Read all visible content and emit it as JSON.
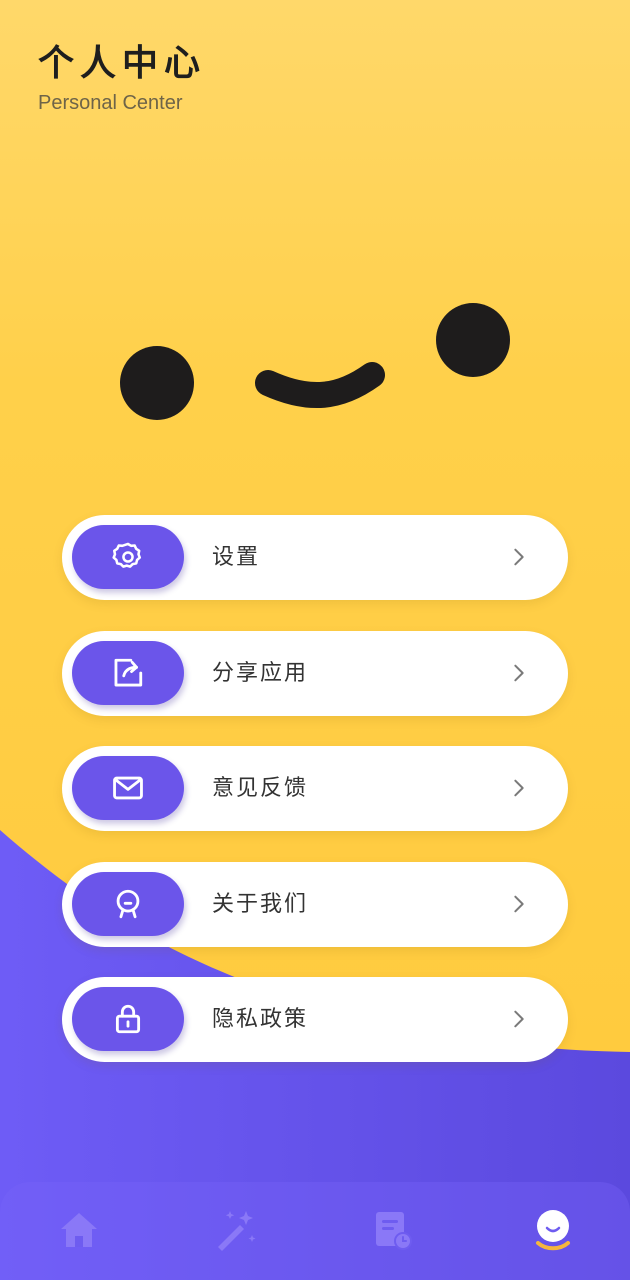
{
  "header": {
    "title": "个人中心",
    "subtitle": "Personal Center"
  },
  "menu": [
    {
      "label": "设置",
      "icon": "gear-icon"
    },
    {
      "label": "分享应用",
      "icon": "share-icon"
    },
    {
      "label": "意见反馈",
      "icon": "mail-icon"
    },
    {
      "label": "关于我们",
      "icon": "about-icon"
    },
    {
      "label": "隐私政策",
      "icon": "lock-icon"
    }
  ],
  "tabbar": {
    "items": [
      {
        "icon": "home-icon",
        "active": false
      },
      {
        "icon": "magic-wand-icon",
        "active": false
      },
      {
        "icon": "document-clock-icon",
        "active": false
      },
      {
        "icon": "smile-face-icon",
        "active": true
      }
    ]
  },
  "colors": {
    "background_yellow": "#FFD04A",
    "accent_purple": "#6B55EA",
    "card_white": "#FFFFFF",
    "active_tab_underline": "#F5B63C"
  }
}
